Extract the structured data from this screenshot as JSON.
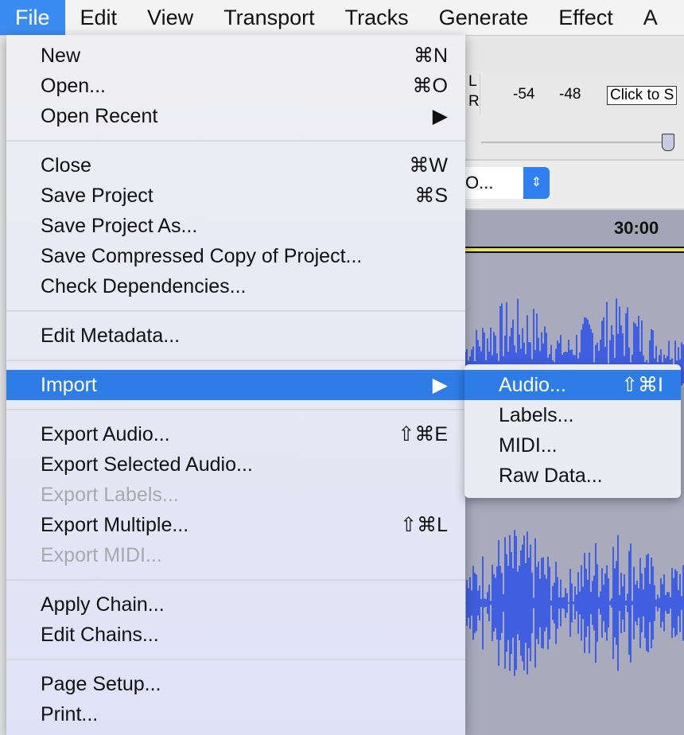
{
  "menubar": [
    "File",
    "Edit",
    "View",
    "Transport",
    "Tracks",
    "Generate",
    "Effect",
    "A"
  ],
  "toolbar": {
    "meter_l": "L",
    "meter_r": "R",
    "tick1": "-54",
    "tick2": "-48",
    "meter_hint": "Click to S",
    "device_value": "O...",
    "timeline": "30:00"
  },
  "file_menu": {
    "items": [
      {
        "label": "New",
        "shortcut": "⌘N"
      },
      {
        "label": "Open...",
        "shortcut": "⌘O"
      },
      {
        "label": "Open Recent",
        "shortcut": "▶"
      },
      {
        "label": "Close",
        "shortcut": "⌘W"
      },
      {
        "label": "Save Project",
        "shortcut": "⌘S"
      },
      {
        "label": "Save Project As...",
        "shortcut": ""
      },
      {
        "label": "Save Compressed Copy of Project...",
        "shortcut": ""
      },
      {
        "label": "Check Dependencies...",
        "shortcut": ""
      },
      {
        "label": "Edit Metadata...",
        "shortcut": ""
      },
      {
        "label": "Import",
        "shortcut": "▶"
      },
      {
        "label": "Export Audio...",
        "shortcut": "⇧⌘E"
      },
      {
        "label": "Export Selected Audio...",
        "shortcut": ""
      },
      {
        "label": "Export Labels...",
        "shortcut": ""
      },
      {
        "label": "Export Multiple...",
        "shortcut": "⇧⌘L"
      },
      {
        "label": "Export MIDI...",
        "shortcut": ""
      },
      {
        "label": "Apply Chain...",
        "shortcut": ""
      },
      {
        "label": "Edit Chains...",
        "shortcut": ""
      },
      {
        "label": "Page Setup...",
        "shortcut": ""
      },
      {
        "label": "Print...",
        "shortcut": ""
      }
    ]
  },
  "import_submenu": {
    "items": [
      {
        "label": "Audio...",
        "shortcut": "⇧⌘I"
      },
      {
        "label": "Labels...",
        "shortcut": ""
      },
      {
        "label": "MIDI...",
        "shortcut": ""
      },
      {
        "label": "Raw Data...",
        "shortcut": ""
      }
    ]
  },
  "colors": {
    "highlight": "#2e7de6",
    "waveform": "#3f5fe0",
    "track_bg": "#a9abbd"
  }
}
